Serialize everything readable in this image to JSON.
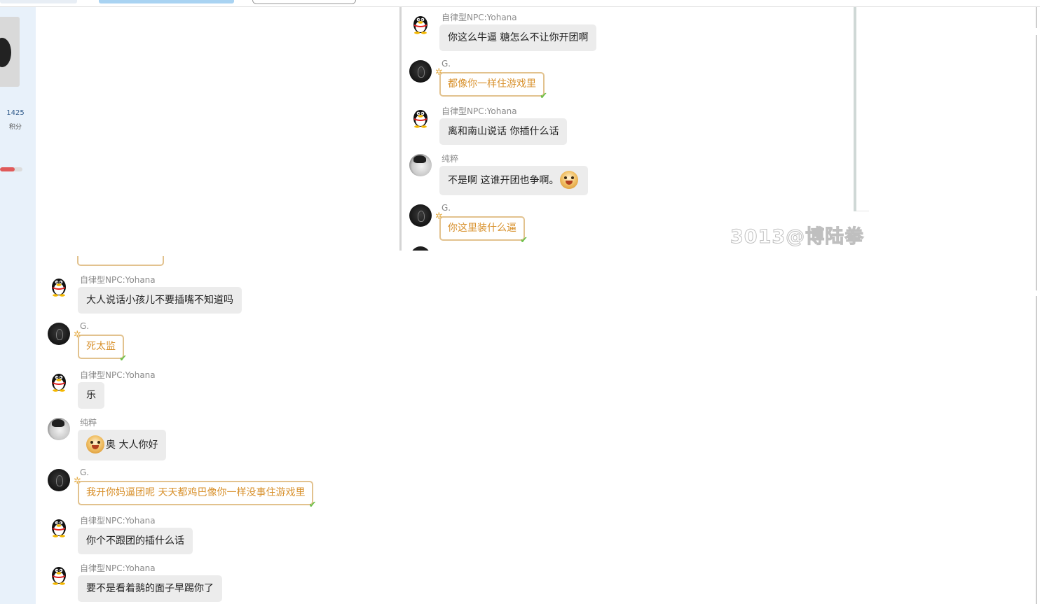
{
  "sidebar": {
    "score_value": "1425",
    "score_unit": "积分",
    "progress_fraction": 0.65
  },
  "names": {
    "npc": "自律型NPC:Yohana",
    "g": "G.",
    "chuncui": "纯粹"
  },
  "inset_screenshot": {
    "watermark": "3013@博陆拳",
    "messages": [
      {
        "sender": "自律型NPC:Yohana",
        "text": "你这么牛逼 糖怎么不让你开团啊"
      },
      {
        "sender": "G.",
        "text": "都像你一样住游戏里"
      },
      {
        "sender": "自律型NPC:Yohana",
        "text": "离和南山说话 你插什么话"
      },
      {
        "sender": "纯粹",
        "text": "不是啊 这谁开团也争啊。"
      },
      {
        "sender": "G.",
        "text": "你这里装什么逼"
      }
    ]
  },
  "chat": {
    "messages": [
      {
        "sender": "自律型NPC:Yohana",
        "text": "大人说话小孩儿不要插嘴不知道吗"
      },
      {
        "sender": "G.",
        "text": "死太监"
      },
      {
        "sender": "自律型NPC:Yohana",
        "text": "乐"
      },
      {
        "sender": "纯粹",
        "text": "奥 大人你好"
      },
      {
        "sender": "G.",
        "text": "我开你妈逼团呢 天天都鸡巴像你一样没事住游戏里"
      },
      {
        "sender": "自律型NPC:Yohana",
        "text": "你个不跟团的插什么话"
      },
      {
        "sender": "自律型NPC:Yohana",
        "text": "要不是看着鹅的面子早踢你了"
      }
    ]
  },
  "icons": {
    "npc_avatar": "penguin-avatar-icon",
    "g_avatar": "dark-avatar-icon",
    "chuncui_avatar": "portrait-avatar-icon",
    "emoji": "grinning-dog-emoji-icon",
    "vip_star": "sparkle-icon",
    "vip_check": "check-icon"
  },
  "colors": {
    "vip_text": "#d8912d",
    "vip_border": "#e2c28e",
    "bubble_bg": "#ececec",
    "sidebar_bg": "#e8f1fa"
  }
}
